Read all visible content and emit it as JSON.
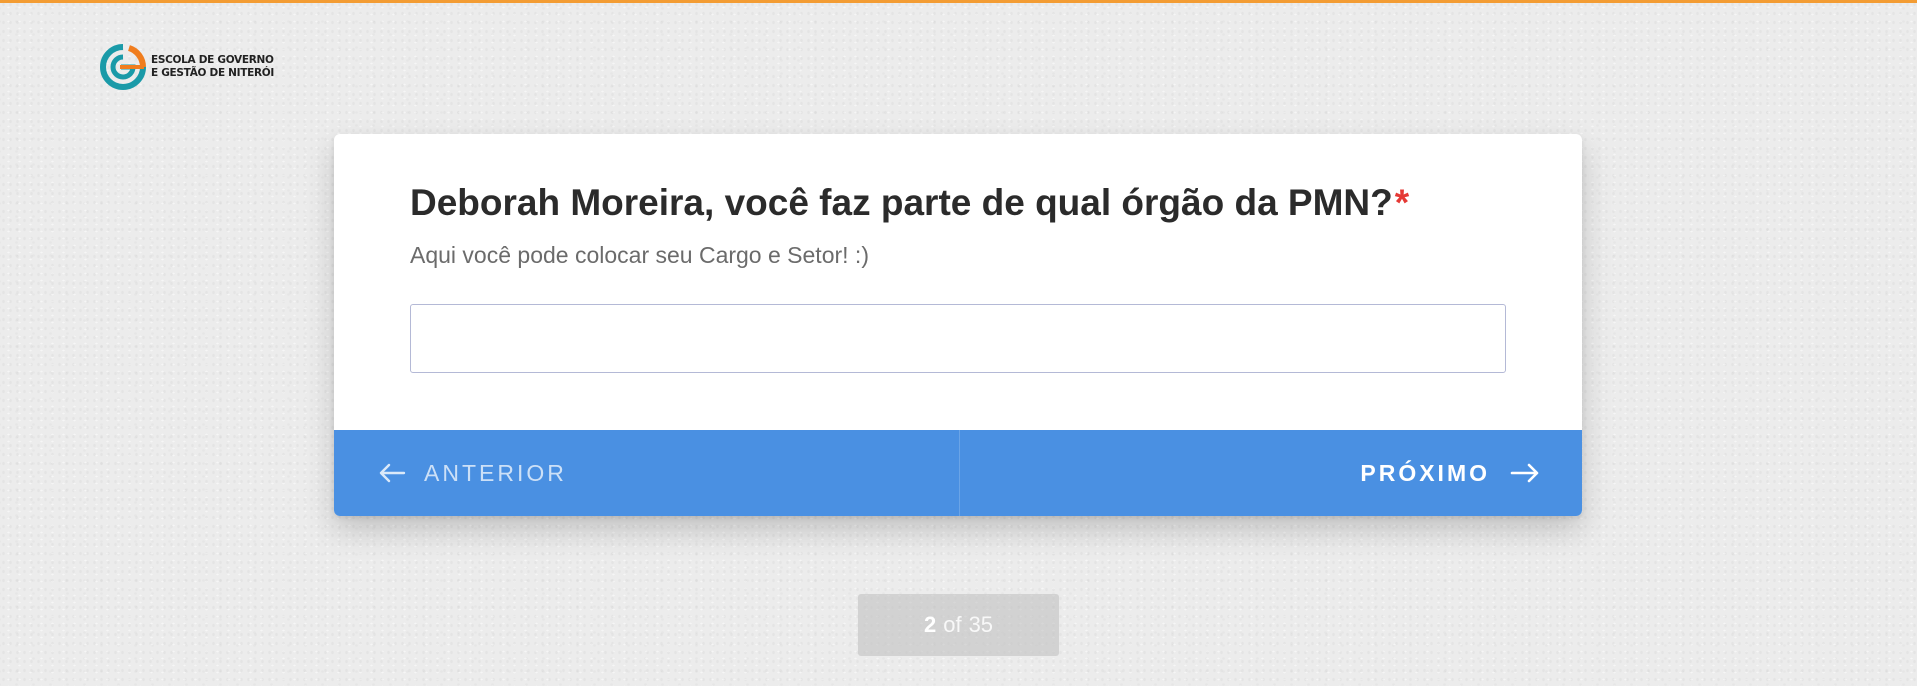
{
  "colors": {
    "top_bar": "#f39c33",
    "nav_bar": "#4a90e2",
    "required": "#e53935",
    "logo_teal": "#1a9aa8",
    "logo_orange": "#f07d1e"
  },
  "logo": {
    "icon": "escola-governo-logo-icon",
    "line1": "ESCOLA DE GOVERNO",
    "line2": "E GESTÃO DE NITERÓI"
  },
  "question": {
    "title": "Deborah Moreira, você faz parte de qual órgão da PMN?",
    "required_mark": "*",
    "hint": "Aqui você pode colocar seu Cargo e Setor! :)",
    "answer_value": "",
    "answer_placeholder": ""
  },
  "navigation": {
    "prev_label": "ANTERIOR",
    "prev_icon": "arrow-left-icon",
    "next_label": "PRÓXIMO",
    "next_icon": "arrow-right-icon"
  },
  "progress": {
    "current": "2",
    "separator": "of",
    "total": "35"
  }
}
